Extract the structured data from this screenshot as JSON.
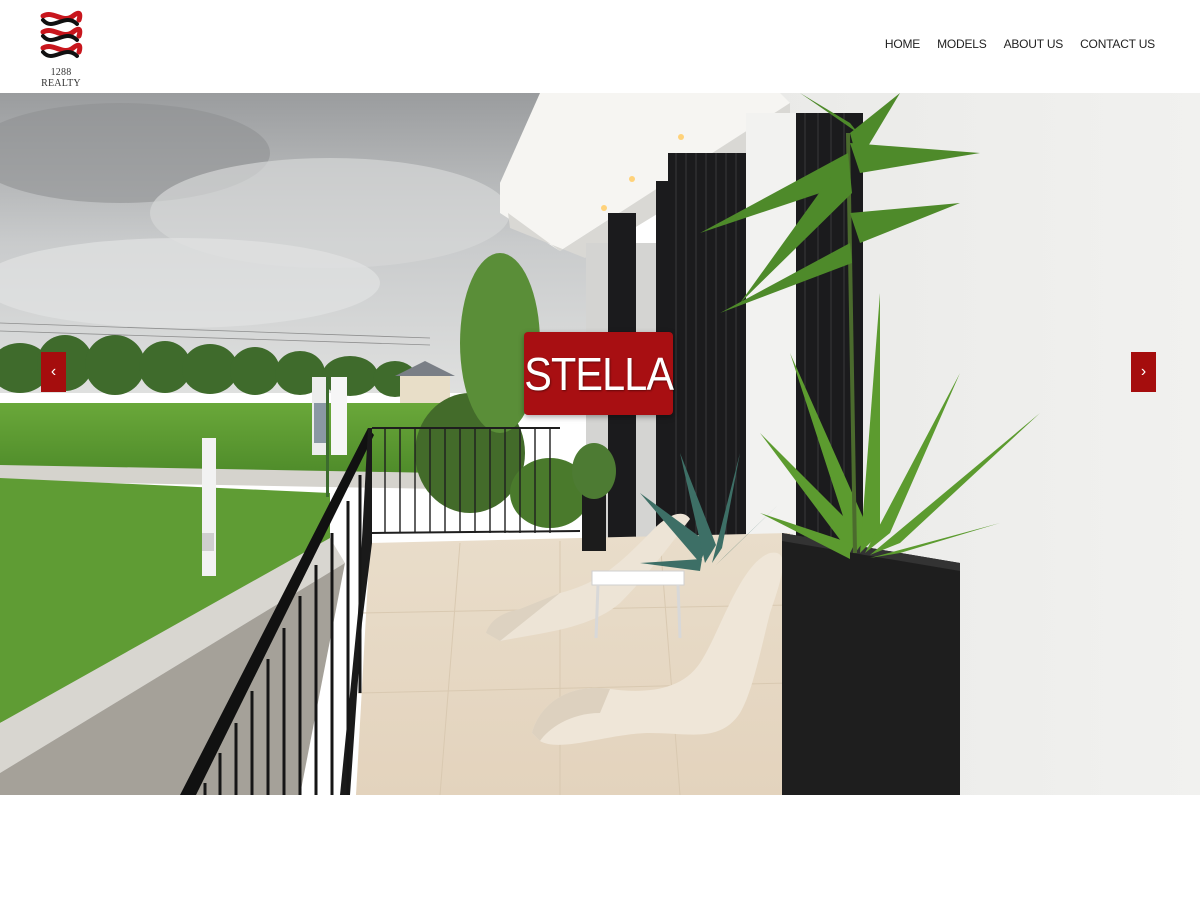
{
  "brand": {
    "name": "1288 REALTY",
    "logo_colors": [
      "#c8161d",
      "#111111"
    ]
  },
  "nav": {
    "items": [
      {
        "label": "HOME"
      },
      {
        "label": "MODELS"
      },
      {
        "label": "ABOUT US"
      },
      {
        "label": "CONTACT US"
      }
    ]
  },
  "hero": {
    "title": "STELLA",
    "title_bg": "#a80f12",
    "prev_icon": "‹",
    "next_icon": "›",
    "image_subject": "balcony-with-lounge-chairs-and-plants"
  },
  "colors": {
    "accent": "#a50d0d",
    "header_bg": "#ffffff",
    "nav_text": "#222222"
  }
}
